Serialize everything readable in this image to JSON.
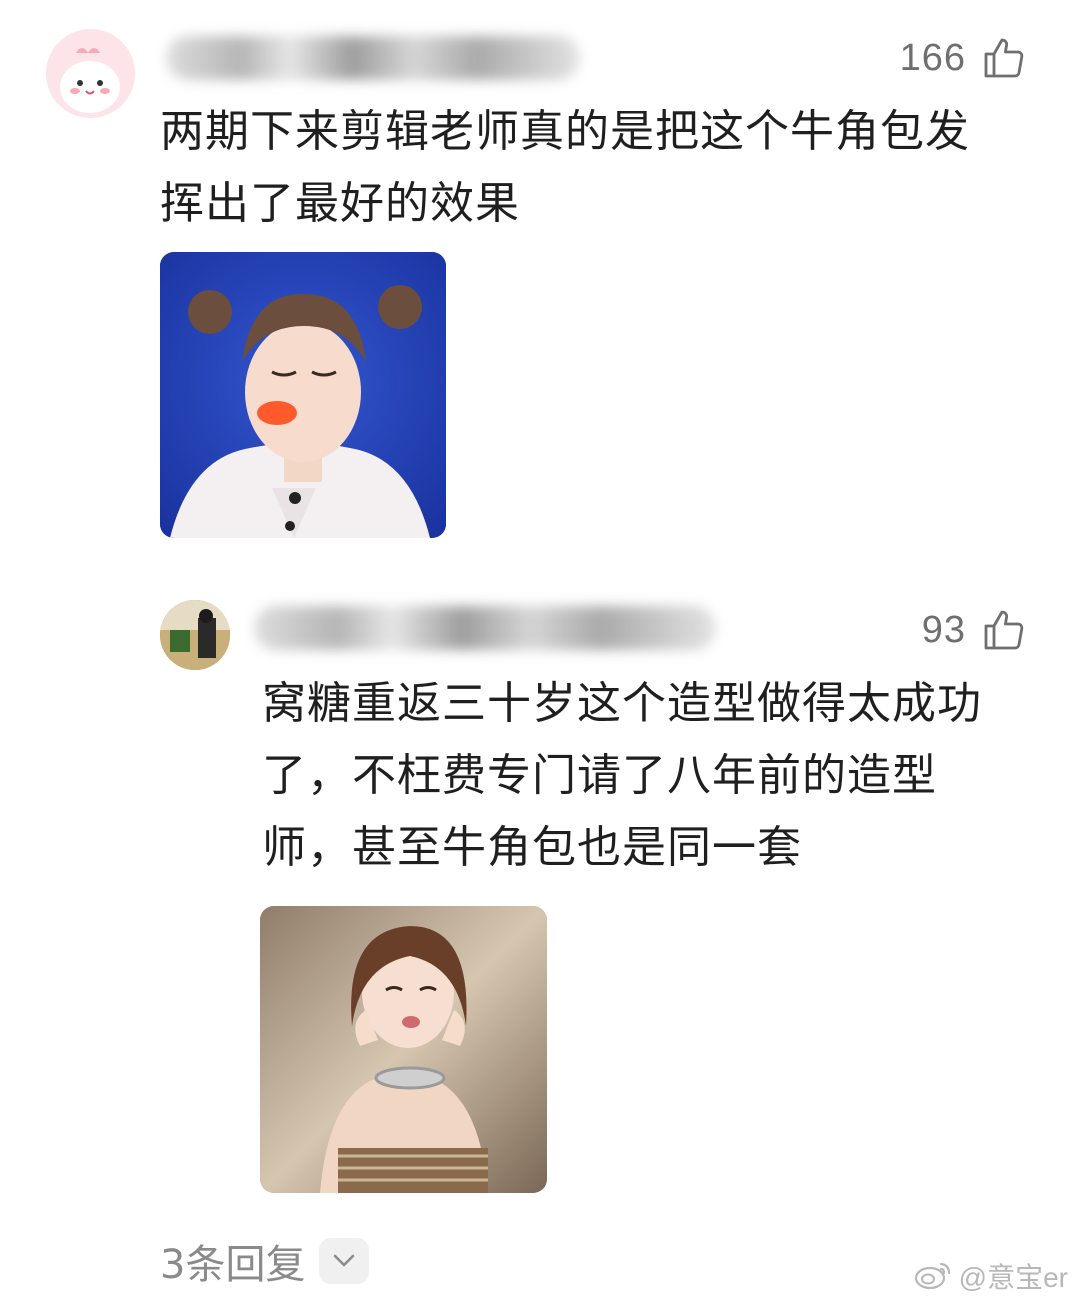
{
  "comments": [
    {
      "likes": "166",
      "text_lines": [
        "两期下来剪辑老师真的是把这个牛角包发",
        "挥出了最好的效果"
      ]
    },
    {
      "likes": "93",
      "text_lines": [
        "窝糖重返三十岁这个造型做得太成功",
        "了，不枉费专门请了八年前的造型",
        "师，甚至牛角包也是同一套"
      ]
    }
  ],
  "replies": {
    "label": "3条回复"
  },
  "watermark": {
    "text": "@意宝er",
    "icon": "weibo-icon"
  },
  "icons": {
    "like": "thumbs-up-icon",
    "expand": "chevron-down-icon"
  },
  "colors": {
    "text": "#1f1f1f",
    "meta": "#6f6f6f",
    "photo1_bg": "#1f3fb0",
    "photo2_bg": "#b9a48c"
  }
}
